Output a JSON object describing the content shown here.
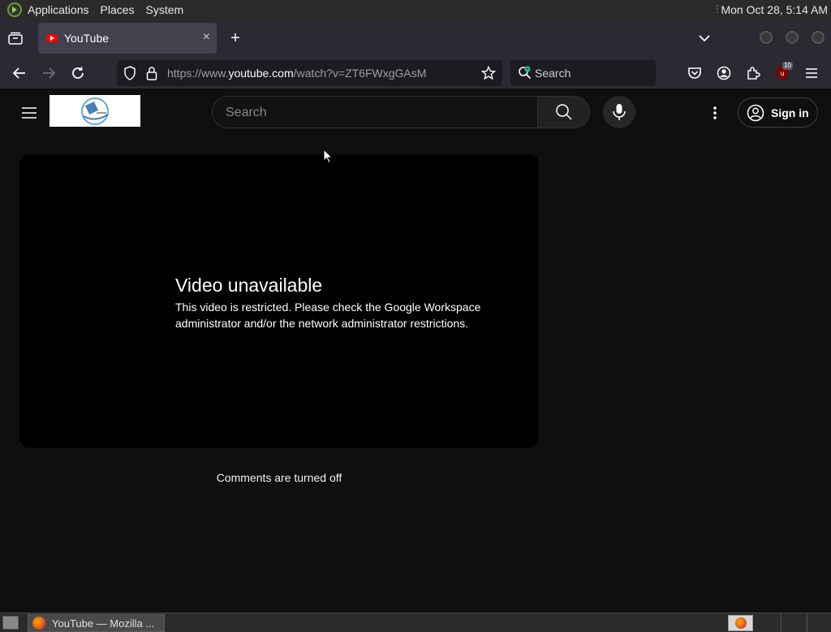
{
  "system_bar": {
    "menus": [
      "Applications",
      "Places",
      "System"
    ],
    "clock": "Mon Oct 28,  5:14 AM"
  },
  "browser": {
    "tab": {
      "title": "YouTube",
      "close_glyph": "×",
      "favicon": "youtube-icon"
    },
    "new_tab_glyph": "+",
    "url": {
      "prefix": "https://www.",
      "domain": "youtube.com",
      "path": "/watch?v=ZT6FWxgGAsM"
    },
    "search_label": "Search",
    "extension_badge": "10",
    "accent": "#ff0000"
  },
  "youtube": {
    "search_placeholder": "Search",
    "sign_in": "Sign in",
    "player": {
      "title": "Video unavailable",
      "message": "This video is restricted. Please check the Google Workspace administrator and/or the network administrator restrictions."
    },
    "comments_status": "Comments are turned off"
  },
  "taskbar": {
    "window_title": "YouTube — Mozilla ..."
  }
}
